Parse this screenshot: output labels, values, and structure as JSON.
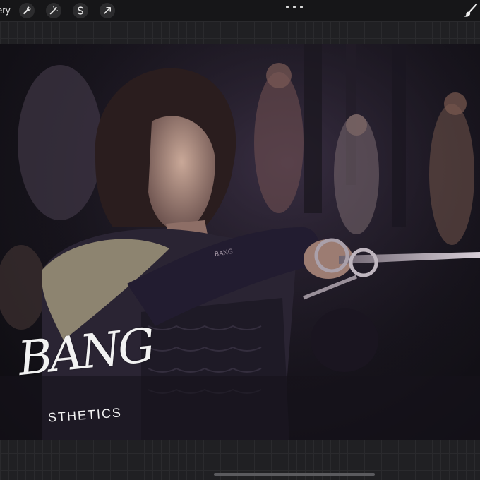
{
  "toolbar": {
    "gallery_label": "ery",
    "tools": [
      {
        "name": "wrench-icon"
      },
      {
        "name": "magic-wand-icon"
      },
      {
        "name": "selection-s-icon"
      },
      {
        "name": "transform-arrow-icon"
      }
    ],
    "more_icon": "more-dots-icon",
    "brush_icon": "brush-icon"
  },
  "artwork": {
    "signature_main": "BANG",
    "signature_sub": "STHETICS",
    "signature_small": "BANG"
  },
  "colors": {
    "toolbar_bg": "#161618",
    "workspace_bg": "#202023",
    "signature": "#f2f2f2"
  }
}
